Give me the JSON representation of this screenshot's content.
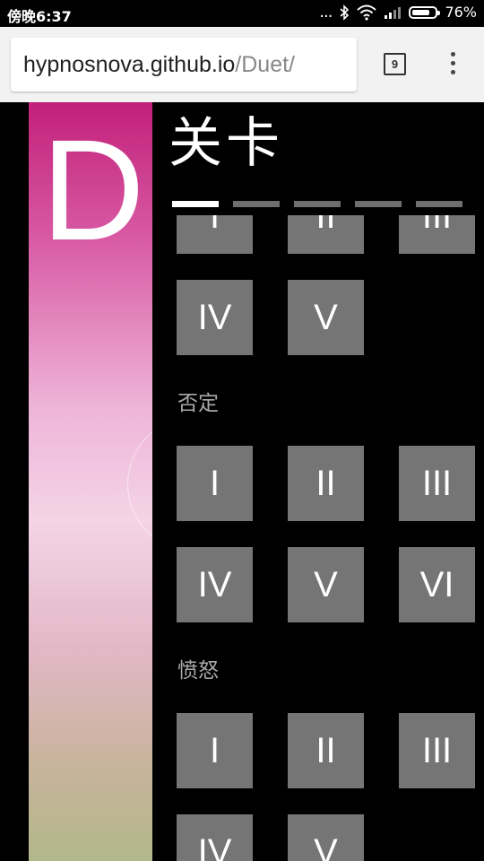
{
  "status_bar": {
    "time": "傍晚6:37",
    "dots": "...",
    "battery_percent": "76%",
    "battery_level": 0.76,
    "icons": [
      "bluetooth-icon",
      "wifi-icon",
      "signal-icon",
      "battery-icon"
    ]
  },
  "browser": {
    "url_host": "hypnosnova.github.io",
    "url_path": "/Duet/",
    "tab_count": "9"
  },
  "side": {
    "letter": "D"
  },
  "header": {
    "title": "关卡",
    "tabs": [
      {
        "active": true
      },
      {
        "active": false
      },
      {
        "active": false
      },
      {
        "active": false
      },
      {
        "active": false
      }
    ]
  },
  "sections": [
    {
      "label": "",
      "levels": [
        "I",
        "II",
        "III",
        "IV",
        "V"
      ]
    },
    {
      "label": "否定",
      "levels": [
        "I",
        "II",
        "III",
        "IV",
        "V",
        "VI"
      ]
    },
    {
      "label": "愤怒",
      "levels": [
        "I",
        "II",
        "III",
        "IV",
        "V"
      ]
    }
  ],
  "colors": {
    "background": "#000000",
    "button": "#757575",
    "tab_inactive": "#6e6e6e",
    "tab_active": "#ffffff",
    "browser_bar": "#f2f2f2"
  }
}
